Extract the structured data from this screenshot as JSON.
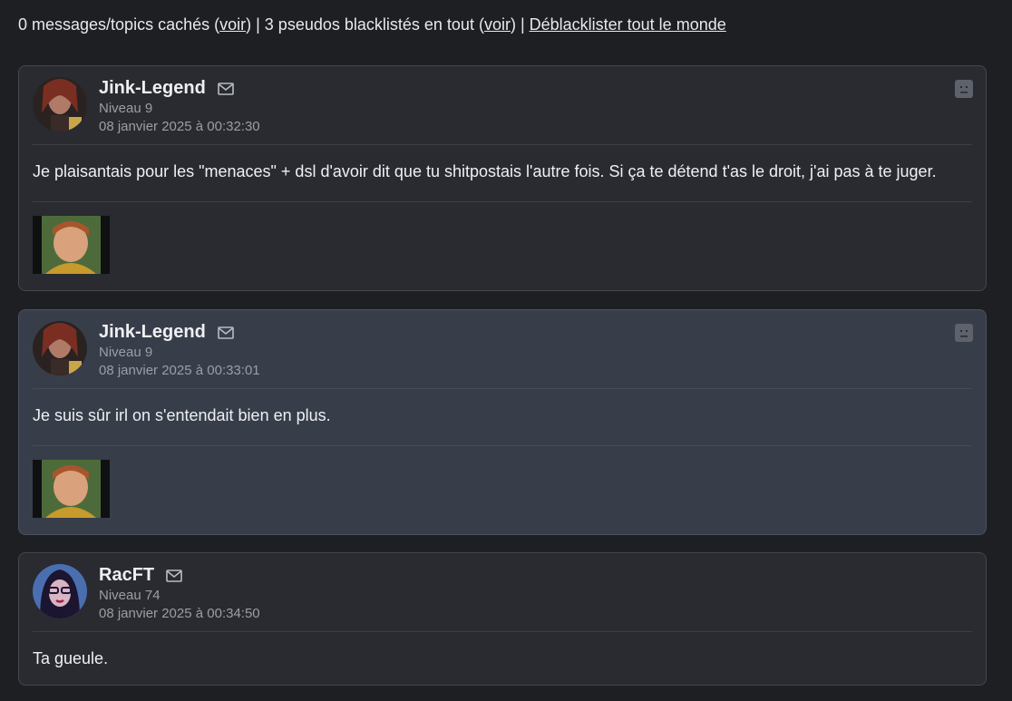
{
  "topbar": {
    "part1": "0 messages/topics cachés (",
    "voir1": "voir",
    "part2": ") | 3 pseudos blacklistés en tout (",
    "voir2": "voir",
    "part3": ") | ",
    "unblacklist": "Déblacklister tout le monde"
  },
  "posts": [
    {
      "author": "Jink-Legend",
      "level": "Niveau 9",
      "date": "08 janvier 2025 à 00:32:30",
      "message": "Je plaisantais pour les \"menaces\" + dsl d'avoir dit que tu shitpostais l'autre fois. Si ça te détend t'as le droit, j'ai pas à te juger.",
      "icons": [
        "mail-icon",
        "report-icon"
      ]
    },
    {
      "author": "Jink-Legend",
      "level": "Niveau 9",
      "date": "08 janvier 2025 à 00:33:01",
      "message": "Je suis sûr irl on s'entendait bien en plus.",
      "icons": [
        "mail-icon",
        "report-icon"
      ]
    },
    {
      "author": "RacFT",
      "level": "Niveau 74",
      "date": "08 janvier 2025 à 00:34:50",
      "message": "Ta gueule.",
      "icons": [
        "mail-icon"
      ]
    }
  ],
  "colors": {
    "background": "#1d1f23",
    "post": "#292b30",
    "post_highlight": "#383d4a",
    "muted_text": "#9a9ea6"
  }
}
